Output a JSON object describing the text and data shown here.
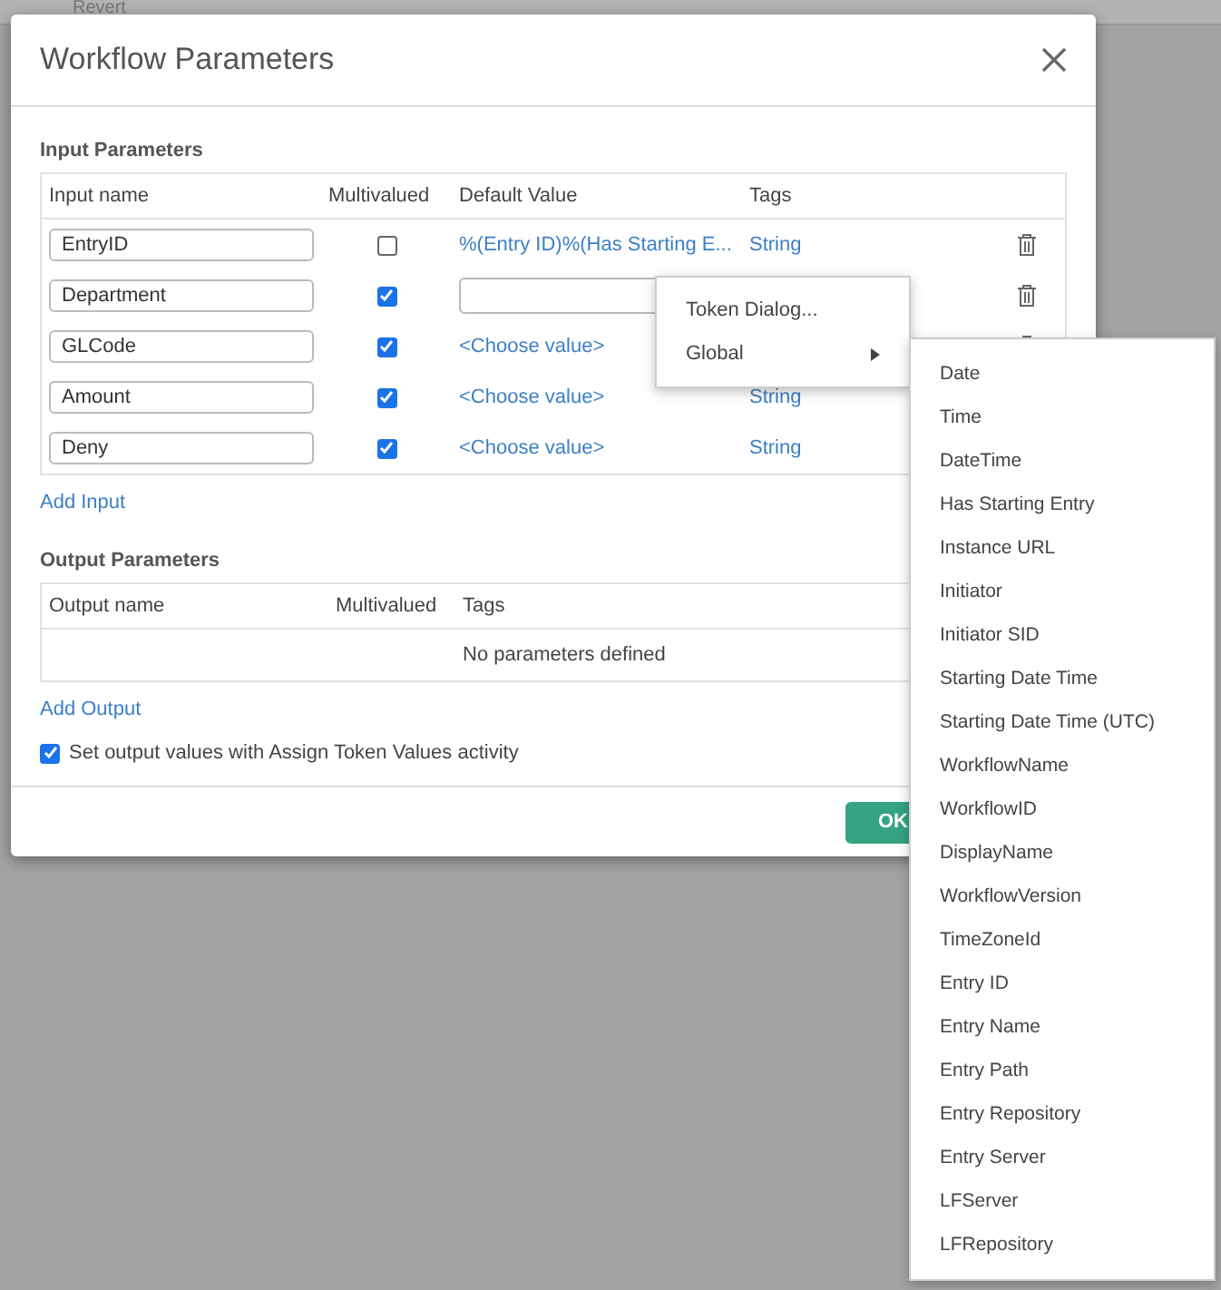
{
  "toolbar": {
    "label": "Revert"
  },
  "dialog": {
    "title": "Workflow Parameters",
    "input_section": {
      "title": "Input Parameters",
      "columns": [
        "Input name",
        "Multivalued",
        "Default Value",
        "Tags"
      ],
      "rows": [
        {
          "name": "EntryID",
          "multivalued": false,
          "default": {
            "kind": "token",
            "text": "%(Entry ID)%(Has Starting E..."
          },
          "tag": "String"
        },
        {
          "name": "Department",
          "multivalued": true,
          "default": {
            "kind": "field"
          }
        },
        {
          "name": "GLCode",
          "multivalued": true,
          "default": {
            "kind": "choose",
            "text": "<Choose value>"
          }
        },
        {
          "name": "Amount",
          "multivalued": true,
          "default": {
            "kind": "choose",
            "text": "<Choose value>"
          },
          "tag": "String"
        },
        {
          "name": "Deny",
          "multivalued": true,
          "default": {
            "kind": "choose",
            "text": "<Choose value>"
          },
          "tag": "String"
        }
      ],
      "add_link": "Add Input"
    },
    "output_section": {
      "title": "Output Parameters",
      "columns": [
        "Output name",
        "Multivalued",
        "Tags"
      ],
      "empty_message": "No parameters defined",
      "add_link": "Add Output"
    },
    "assign_option": {
      "label": "Set output values with Assign Token Values activity",
      "checked": true
    },
    "buttons": [
      "OK"
    ]
  },
  "context_menu": {
    "items": [
      {
        "label": "Token Dialog...",
        "submenu": false
      },
      {
        "label": "Global",
        "submenu": true
      }
    ]
  },
  "submenu": {
    "items": [
      "Date",
      "Time",
      "DateTime",
      "Has Starting Entry",
      "Instance URL",
      "Initiator",
      "Initiator SID",
      "Starting Date Time",
      "Starting Date Time (UTC)",
      "WorkflowName",
      "WorkflowID",
      "DisplayName",
      "WorkflowVersion",
      "TimeZoneId",
      "Entry ID",
      "Entry Name",
      "Entry Path",
      "Entry Repository",
      "Entry Server",
      "LFServer",
      "LFRepository"
    ]
  }
}
